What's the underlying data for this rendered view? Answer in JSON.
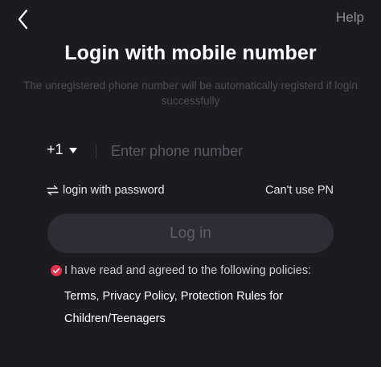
{
  "nav": {
    "back_icon": "chevron-left-icon",
    "help_label": "Help"
  },
  "header": {
    "title": "Login with mobile number",
    "subtitle": "The unregistered phone number will be automatically registerd if login successfully"
  },
  "phone": {
    "country_code": "+1",
    "placeholder": "Enter phone number",
    "value": ""
  },
  "alternatives": {
    "password_icon": "swap-arrows-icon",
    "password_label": "login with password",
    "cant_use_label": "Can't use PN"
  },
  "login_button_label": "Log in",
  "agreement": {
    "checked": true,
    "text": "I have read and agreed to the following policies:",
    "links": [
      "Terms",
      "Privacy Policy",
      "Protection Rules for Children/Teenagers"
    ],
    "separator": ","
  },
  "colors": {
    "background": "#1c1b20",
    "button": "#2e2d33",
    "check": "#e5304a",
    "muted_text": "#8e8d93"
  }
}
